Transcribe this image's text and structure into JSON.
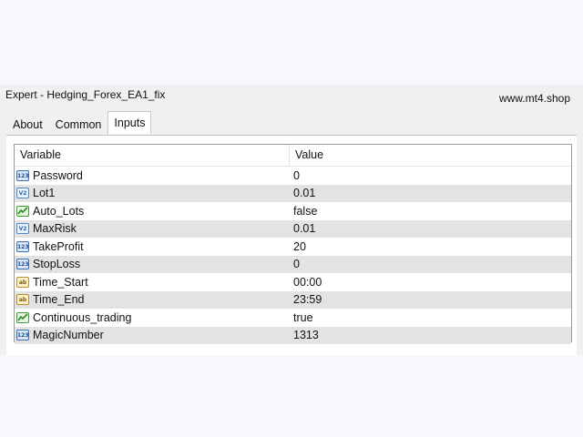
{
  "window": {
    "title": "Expert - Hedging_Forex_EA1_fix",
    "watermark": "www.mt4.shop"
  },
  "tabs": [
    {
      "label": "About",
      "active": false
    },
    {
      "label": "Common",
      "active": false
    },
    {
      "label": "Inputs",
      "active": true
    }
  ],
  "table": {
    "headers": {
      "variable": "Variable",
      "value": "Value"
    },
    "rows": [
      {
        "icon": "int",
        "icon_text": "123",
        "name": "Password",
        "value": "0"
      },
      {
        "icon": "dbl",
        "icon_text": "V2",
        "name": "Lot1",
        "value": "0.01"
      },
      {
        "icon": "bool",
        "icon_text": "",
        "name": "Auto_Lots",
        "value": "false"
      },
      {
        "icon": "dbl",
        "icon_text": "V2",
        "name": "MaxRisk",
        "value": "0.01"
      },
      {
        "icon": "int",
        "icon_text": "123",
        "name": "TakeProfit",
        "value": "20"
      },
      {
        "icon": "int",
        "icon_text": "123",
        "name": "StopLoss",
        "value": "0"
      },
      {
        "icon": "str",
        "icon_text": "ab",
        "name": "Time_Start",
        "value": "00:00"
      },
      {
        "icon": "str",
        "icon_text": "ab",
        "name": "Time_End",
        "value": "23:59"
      },
      {
        "icon": "bool",
        "icon_text": "",
        "name": "Continuous_trading",
        "value": "true"
      },
      {
        "icon": "int",
        "icon_text": "123",
        "name": "MagicNumber",
        "value": "1313"
      }
    ]
  }
}
